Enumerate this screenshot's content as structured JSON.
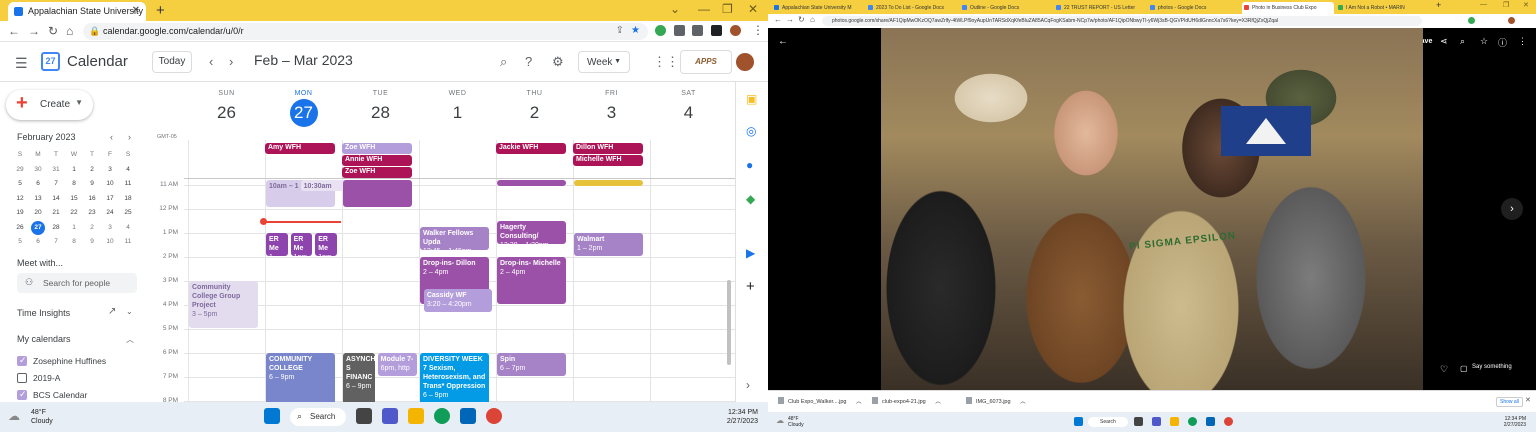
{
  "left_browser": {
    "tab_title": "Appalachian State University - C",
    "url": "calendar.google.com/calendar/u/0/r"
  },
  "calendar": {
    "app_name": "Calendar",
    "logo_day": "27",
    "today_label": "Today",
    "date_range": "Feb – Mar 2023",
    "view_label": "Week",
    "apps_badge": "APPS",
    "create_label": "Create",
    "mini_month_title": "February 2023",
    "weekday_initials": [
      "S",
      "M",
      "T",
      "W",
      "T",
      "F",
      "S"
    ],
    "mini_weeks": [
      [
        "29",
        "30",
        "31",
        "1",
        "2",
        "3",
        "4"
      ],
      [
        "5",
        "6",
        "7",
        "8",
        "9",
        "10",
        "11"
      ],
      [
        "12",
        "13",
        "14",
        "15",
        "16",
        "17",
        "18"
      ],
      [
        "19",
        "20",
        "21",
        "22",
        "23",
        "24",
        "25"
      ],
      [
        "26",
        "27",
        "28",
        "1",
        "2",
        "3",
        "4"
      ],
      [
        "5",
        "6",
        "7",
        "8",
        "9",
        "10",
        "11"
      ]
    ],
    "meet_with": "Meet with...",
    "search_people": "Search for people",
    "time_insights": "Time Insights",
    "my_calendars": "My calendars",
    "calendars": [
      {
        "name": "Zosephine Huffines",
        "checked": true
      },
      {
        "name": "2019-A",
        "checked": false
      },
      {
        "name": "BCS Calendar",
        "checked": true
      }
    ],
    "gmt": "GMT-05",
    "days": [
      {
        "name": "SUN",
        "num": "26"
      },
      {
        "name": "MON",
        "num": "27"
      },
      {
        "name": "TUE",
        "num": "28"
      },
      {
        "name": "WED",
        "num": "1"
      },
      {
        "name": "THU",
        "num": "2"
      },
      {
        "name": "FRI",
        "num": "3"
      },
      {
        "name": "SAT",
        "num": "4"
      }
    ],
    "allday": [
      {
        "title": "Amy WFH",
        "day": 1,
        "row": 0,
        "color": "#ad1457"
      },
      {
        "title": "Zoe WFH",
        "day": 2,
        "row": 0,
        "color": "#b39ddb"
      },
      {
        "title": "Annie WFH",
        "day": 2,
        "row": 1,
        "color": "#ad1457"
      },
      {
        "title": "Zoe WFH",
        "day": 2,
        "row": 2,
        "color": "#ad1457"
      },
      {
        "title": "Jackie WFH",
        "day": 4,
        "row": 0,
        "color": "#ad1457"
      },
      {
        "title": "Dillon WFH",
        "day": 5,
        "row": 0,
        "color": "#ad1457"
      },
      {
        "title": "Michelle WFH",
        "day": 5,
        "row": 1,
        "color": "#ad1457"
      }
    ],
    "time_labels": [
      "11 AM",
      "12 PM",
      "1 PM",
      "2 PM",
      "3 PM",
      "4 PM",
      "5 PM",
      "6 PM",
      "7 PM",
      "8 PM"
    ],
    "events": [
      {
        "title": "10am – 1",
        "time": "",
        "day": 1,
        "start": 10.8,
        "end": 11.95,
        "color": "#d7cdea",
        "light": true
      },
      {
        "title": "10:30am",
        "time": "",
        "day": 1,
        "start": 10.8,
        "end": 11.3,
        "color": "#e8e2f2",
        "light": true,
        "offset": 0.45
      },
      {
        "title": "",
        "time": "",
        "day": 2,
        "start": 10.8,
        "end": 11.95,
        "color": "#9c51a8"
      },
      {
        "title": "",
        "time": "",
        "day": 4,
        "start": 10.8,
        "end": 11.0,
        "color": "#9c51a8"
      },
      {
        "title": "",
        "time": "",
        "day": 5,
        "start": 10.8,
        "end": 11.0,
        "color": "#e6c13a"
      },
      {
        "title": "ER Me",
        "time": "1 – 2p",
        "day": 1,
        "start": 13.0,
        "end": 14.0,
        "color": "#8e44ad",
        "w": 0.32
      },
      {
        "title": "ER Me",
        "time": "1pm, F",
        "day": 1,
        "start": 13.0,
        "end": 14.0,
        "color": "#8e44ad",
        "w": 0.32,
        "offset": 0.32
      },
      {
        "title": "ER Me",
        "time": "1pm, F",
        "day": 1,
        "start": 13.0,
        "end": 14.0,
        "color": "#8e44ad",
        "w": 0.32,
        "offset": 0.64
      },
      {
        "title": "Walker Fellows Upda",
        "time": "12:45 – 1:45pm",
        "day": 3,
        "start": 12.75,
        "end": 13.75,
        "color": "#a682c7"
      },
      {
        "title": "Hagerty Consulting/",
        "time": "12:30 – 1:30pm",
        "day": 4,
        "start": 12.5,
        "end": 13.5,
        "color": "#9c51a8"
      },
      {
        "title": "Walmart",
        "time": "1 – 2pm",
        "day": 5,
        "start": 13.0,
        "end": 14.0,
        "color": "#a682c7"
      },
      {
        "title": "Drop-ins- Dillon",
        "time": "2 – 4pm",
        "day": 3,
        "start": 14.0,
        "end": 16.0,
        "color": "#9c51a8"
      },
      {
        "title": "Cassidy WF",
        "time": "3:20 – 4:20pm",
        "day": 3,
        "start": 15.33,
        "end": 16.33,
        "color": "#b39ddb",
        "offset": 0.05
      },
      {
        "title": "Drop-ins- Michelle",
        "time": "2 – 4pm",
        "day": 4,
        "start": 14.0,
        "end": 16.0,
        "color": "#9c51a8"
      },
      {
        "title": "Community College Group Project",
        "time": "3 – 5pm",
        "day": 0,
        "start": 15.0,
        "end": 17.0,
        "color": "#e3dcef",
        "light": true
      },
      {
        "title": "COMMUNITY COLLEGE",
        "time": "6 – 9pm",
        "day": 1,
        "start": 18.0,
        "end": 21.0,
        "color": "#7986cb"
      },
      {
        "title": "ASYNCHR S FINANC",
        "time": "6 – 9pm",
        "day": 2,
        "start": 18.0,
        "end": 21.0,
        "color": "#616161",
        "w": 0.45
      },
      {
        "title": "Module 7-",
        "time": "6pm, http",
        "day": 2,
        "start": 18.0,
        "end": 19.0,
        "color": "#b39ddb",
        "w": 0.55,
        "offset": 0.45
      },
      {
        "title": "DIVERSITY WEEK 7 Sexism, Heterosexism, and Trans* Oppression",
        "time": "6 – 9pm",
        "day": 3,
        "start": 18.0,
        "end": 21.0,
        "color": "#039be5"
      },
      {
        "title": "Spin",
        "time": "6 – 7pm",
        "day": 4,
        "start": 18.0,
        "end": 19.0,
        "color": "#a682c7"
      }
    ]
  },
  "left_taskbar": {
    "temp": "48°F",
    "condition": "Cloudy",
    "search": "Search",
    "time": "12:34 PM",
    "date": "2/27/2023"
  },
  "right_browser": {
    "tabs": [
      {
        "title": "Appalachian State University M",
        "color": "#1a73e8",
        "active": false
      },
      {
        "title": "2023 To Do List - Google Docs",
        "color": "#4285f4",
        "active": false
      },
      {
        "title": "Outline - Google Docs",
        "color": "#4285f4",
        "active": false
      },
      {
        "title": "22 TRUST REPORT - US Letter",
        "color": "#4285f4",
        "active": false
      },
      {
        "title": "photos - Google Docs",
        "color": "#4285f4",
        "active": false
      },
      {
        "title": "Photo in Business Club Expo",
        "color": "#ea4335",
        "active": true
      },
      {
        "title": "I Am Not a Robot • MARIN",
        "color": "#34a853",
        "active": false
      }
    ],
    "url": "photos.google.com/share/AF1QipMwOKzOQ7awZrlfy-4tWLPf9oyAupUnTARSdXqKfeBluZA85ACqFogKSabm-NCp7w/photo/AF1QipONbwyTI-y6Wj3sB-QGVPIdUH6dlGnncXa7s6?key=X3RfQjZxQjZqal"
  },
  "photos": {
    "save_label": "Save",
    "shirt_text": "PI SIGMA EPSILON",
    "say_something": "Say something"
  },
  "downloads": [
    {
      "name": "Club Expo_Walker....jpg"
    },
    {
      "name": "club-expo4-21.jpg"
    },
    {
      "name": "IMG_6073.jpg"
    }
  ],
  "show_all": "Show all",
  "right_taskbar": {
    "temp": "48°F",
    "condition": "Cloudy",
    "search": "Search",
    "time": "12:34 PM",
    "date": "2/27/2023"
  },
  "colors": {
    "accent": "#1a73e8",
    "chrome_bar": "#f5cf40",
    "now_line": "#ea4335"
  }
}
